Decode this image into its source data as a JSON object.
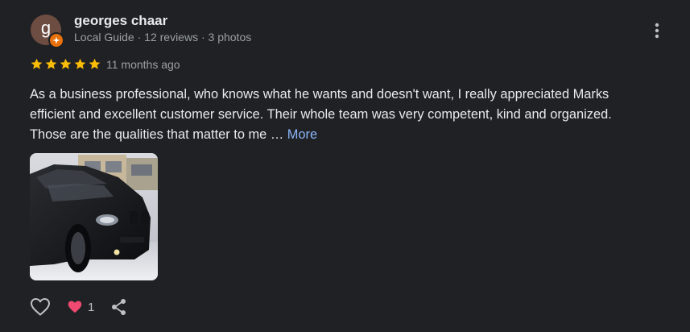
{
  "reviewer": {
    "avatar_letter": "g",
    "name": "georges chaar",
    "meta": "Local Guide · 12 reviews · 3 photos",
    "badge_icon": "local-guide-badge-icon"
  },
  "rating": {
    "stars": 5,
    "max": 5,
    "time": "11 months ago",
    "color": "#fbbc04"
  },
  "review": {
    "lines": [
      "As a business professional, who knows what he wants and doesn't want, I really appreciated Marks",
      "efficient and excellent customer service. Their whole team was very competent, kind and organized.",
      "Those are the qualities that matter to me …"
    ],
    "more_label": "More"
  },
  "actions": {
    "like_count": "1",
    "icons": [
      "heart-outline-icon",
      "heart-reaction-icon",
      "share-icon"
    ]
  },
  "colors": {
    "background": "#202124",
    "text": "#e8eaed",
    "secondary": "#9aa0a6",
    "link": "#8ab4f8",
    "avatar": "#6d4c41",
    "badge": "#e8710a"
  }
}
